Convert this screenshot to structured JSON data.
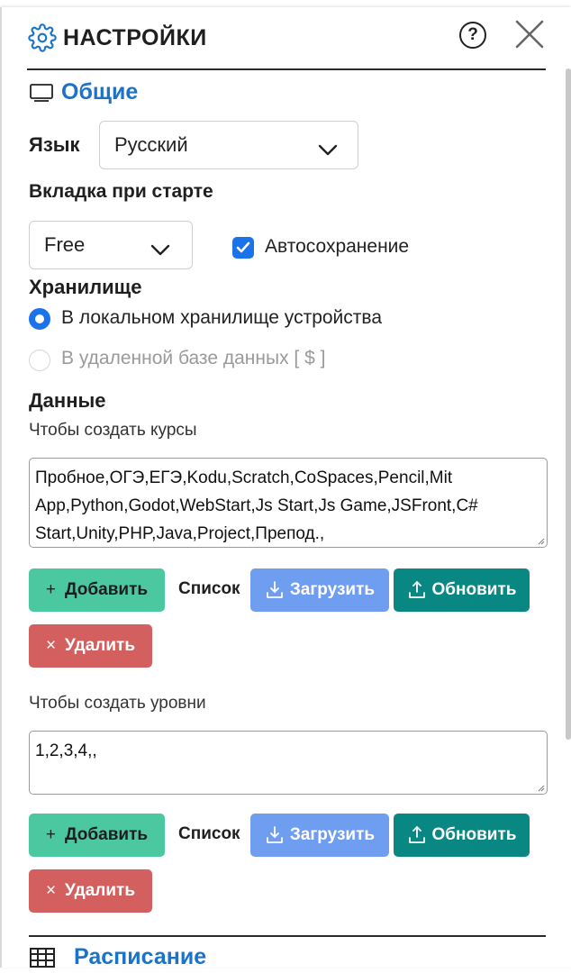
{
  "header": {
    "title": "НАСТРОЙКИ",
    "help_glyph": "?"
  },
  "general": {
    "title": "Общие",
    "language_label": "Язык",
    "language_value": "Русский",
    "start_tab_label": "Вкладка при старте",
    "start_tab_value": "Free",
    "autosave_label": "Автосохранение",
    "autosave_checked": true,
    "storage_label": "Хранилище",
    "storage_options": [
      {
        "label": "В локальном хранилище устройства",
        "selected": true,
        "disabled": false
      },
      {
        "label": "В удаленной базе данных [ $ ]",
        "selected": false,
        "disabled": true
      }
    ]
  },
  "data_section": {
    "title": "Данные",
    "courses": {
      "hint": "Чтобы создать курсы",
      "value": "Пробное,ОГЭ,ЕГЭ,Kodu,Scratch,CoSpaces,Pencil,Mit App,Python,Godot,WebStart,Js Start,Js Game,JSFront,C# Start,Unity,PHP,Java,Project,Препод.,"
    },
    "levels": {
      "hint": "Чтобы создать уровни",
      "value": "1,2,3,4,,"
    },
    "buttons": {
      "add_glyph": "+",
      "add": "Добавить",
      "list": "Список",
      "load": "Загрузить",
      "update": "Обновить",
      "delete_glyph": "×",
      "delete": "Удалить"
    }
  },
  "schedule": {
    "title": "Расписание"
  },
  "colors": {
    "accent": "#1a73c8",
    "add": "#4cc8a1",
    "load": "#6f9ef0",
    "update": "#098783",
    "delete": "#d45f5f"
  },
  "icons": {
    "header": "gear-icon",
    "help": "help-circle-icon",
    "close": "close-icon",
    "general": "monitor-icon",
    "schedule": "table-icon",
    "load": "download-icon",
    "update": "upload-icon"
  }
}
